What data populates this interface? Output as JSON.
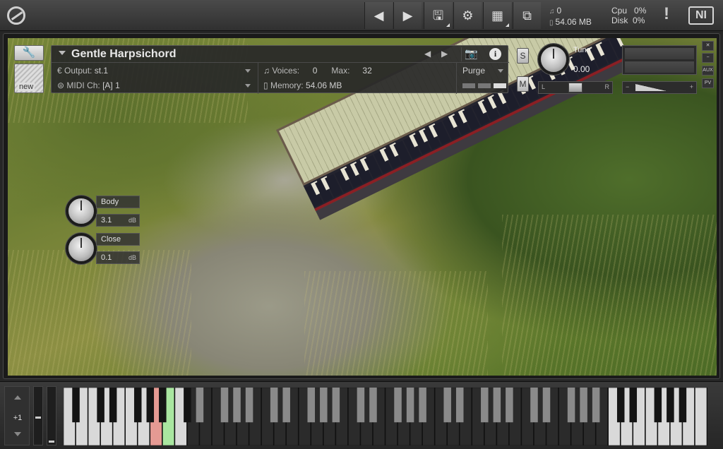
{
  "toolbar": {
    "logo_icon": "kontakt-logo-icon",
    "nav_prev_icon": "triangle-left-icon",
    "nav_next_icon": "triangle-right-icon",
    "save_icon": "floppy-disk-icon",
    "settings_icon": "gear-icon",
    "layout_icon": "layout-icon",
    "resize_icon": "window-resize-icon",
    "voices_value": "0",
    "memory_value": "54.06 MB",
    "cpu_label": "Cpu",
    "cpu_value": "0%",
    "disk_label": "Disk",
    "disk_value": "0%",
    "warning_glyph": "!",
    "ni_logo_text": "NI"
  },
  "instrument": {
    "name": "Gentle Harpsichord",
    "new_label": "new",
    "output_label": "Output:",
    "output_value": "st.1",
    "midi_label": "MIDI Ch:",
    "midi_value": "[A]  1",
    "voices_label": "Voices:",
    "voices_value": "0",
    "max_label": "Max:",
    "max_value": "32",
    "memory_label": "Memory:",
    "memory_value": "54.06 MB",
    "purge_label": "Purge",
    "solo_label": "S",
    "mute_label": "M",
    "tune_label": "Tune",
    "tune_value": "0.00",
    "pan_left": "L",
    "pan_right": "R",
    "vol_minus": "−",
    "vol_plus": "+",
    "side_buttons": [
      "✕",
      "−",
      "AUX",
      "PV"
    ]
  },
  "panel": {
    "body_label": "Body",
    "body_value": "3.1",
    "body_unit": "dB",
    "close_label": "Close",
    "close_value": "0.1",
    "close_unit": "dB"
  },
  "keyboard": {
    "octave_offset": "+1",
    "white_key_count": 52,
    "start_note": "A",
    "playable_range_start": 10,
    "playable_range_end": 44,
    "pressed_red_white_index": 7,
    "pressed_green_white_index": 8,
    "color_red": "#e59a93",
    "color_green": "#a9e6a0"
  }
}
